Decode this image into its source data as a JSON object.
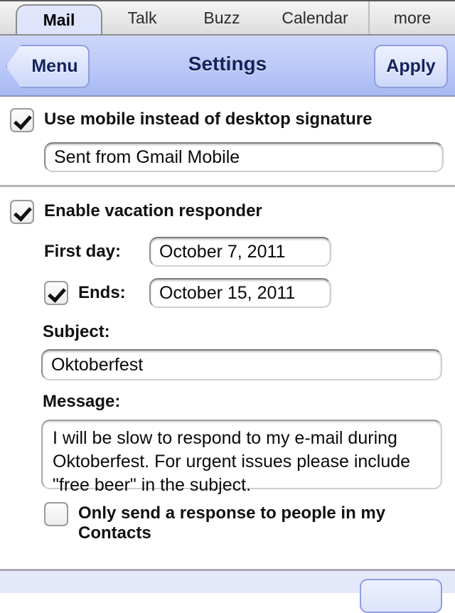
{
  "tabs": [
    {
      "label": "Mail",
      "active": true
    },
    {
      "label": "Talk",
      "active": false
    },
    {
      "label": "Buzz",
      "active": false
    },
    {
      "label": "Calendar",
      "active": false
    },
    {
      "label": "more",
      "active": false
    }
  ],
  "navbar": {
    "back_label": "Menu",
    "title": "Settings",
    "apply_label": "Apply"
  },
  "signature_section": {
    "checkbox_label": "Use mobile instead of desktop signature",
    "checked": true,
    "signature_value": "Sent from Gmail Mobile"
  },
  "vacation_section": {
    "checkbox_label": "Enable vacation responder",
    "checked": true,
    "first_day_label": "First day:",
    "first_day_value": "October 7, 2011",
    "ends_label": "Ends:",
    "ends_checked": true,
    "ends_value": "October 15, 2011",
    "subject_label": "Subject:",
    "subject_value": "Oktoberfest",
    "message_label": "Message:",
    "message_value": "I will be slow to respond to my e-mail during Oktoberfest. For urgent issues please include \"free beer\" in the subject.",
    "contacts_only_label": "Only send a response to people in my Contacts",
    "contacts_only_checked": false
  },
  "colors": {
    "header_top": "#ccd6f8",
    "header_bottom": "#a7b8f4",
    "accent_text": "#13235c",
    "tab_active_bg": "#dde3fb",
    "divider": "#b5b5b5",
    "bottom_bar_bg": "#e4e9fa"
  }
}
